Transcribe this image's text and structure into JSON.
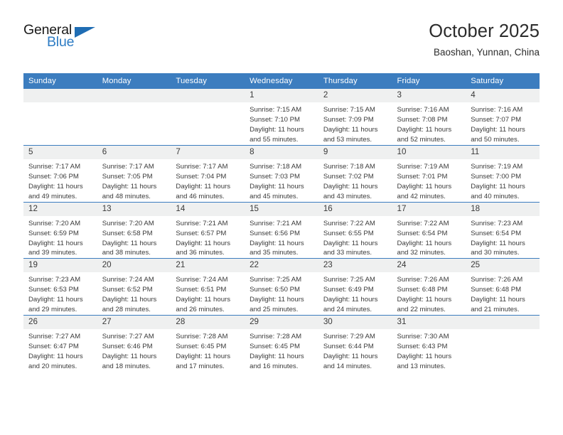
{
  "brand": {
    "name_top": "General",
    "name_bottom": "Blue",
    "triangle_color": "#1f6db4",
    "blue_text_color": "#2e7cc4"
  },
  "header": {
    "title": "October 2025",
    "subtitle": "Baoshan, Yunnan, China"
  },
  "colors": {
    "header_row_bg": "#3c7dbf",
    "header_row_text": "#ffffff",
    "daynum_bg": "#eff0f0",
    "row_divider": "#3c7dbf",
    "body_text": "#3a3a3a"
  },
  "calendar": {
    "weekday_headers": [
      "Sunday",
      "Monday",
      "Tuesday",
      "Wednesday",
      "Thursday",
      "Friday",
      "Saturday"
    ],
    "labels": {
      "sunrise": "Sunrise:",
      "sunset": "Sunset:",
      "daylight": "Daylight:"
    },
    "weeks": [
      [
        {
          "day": "",
          "blank": true
        },
        {
          "day": "",
          "blank": true
        },
        {
          "day": "",
          "blank": true
        },
        {
          "day": "1",
          "sunrise": "Sunrise: 7:15 AM",
          "sunset": "Sunset: 7:10 PM",
          "daylight_1": "Daylight: 11 hours",
          "daylight_2": "and 55 minutes."
        },
        {
          "day": "2",
          "sunrise": "Sunrise: 7:15 AM",
          "sunset": "Sunset: 7:09 PM",
          "daylight_1": "Daylight: 11 hours",
          "daylight_2": "and 53 minutes."
        },
        {
          "day": "3",
          "sunrise": "Sunrise: 7:16 AM",
          "sunset": "Sunset: 7:08 PM",
          "daylight_1": "Daylight: 11 hours",
          "daylight_2": "and 52 minutes."
        },
        {
          "day": "4",
          "sunrise": "Sunrise: 7:16 AM",
          "sunset": "Sunset: 7:07 PM",
          "daylight_1": "Daylight: 11 hours",
          "daylight_2": "and 50 minutes."
        }
      ],
      [
        {
          "day": "5",
          "sunrise": "Sunrise: 7:17 AM",
          "sunset": "Sunset: 7:06 PM",
          "daylight_1": "Daylight: 11 hours",
          "daylight_2": "and 49 minutes."
        },
        {
          "day": "6",
          "sunrise": "Sunrise: 7:17 AM",
          "sunset": "Sunset: 7:05 PM",
          "daylight_1": "Daylight: 11 hours",
          "daylight_2": "and 48 minutes."
        },
        {
          "day": "7",
          "sunrise": "Sunrise: 7:17 AM",
          "sunset": "Sunset: 7:04 PM",
          "daylight_1": "Daylight: 11 hours",
          "daylight_2": "and 46 minutes."
        },
        {
          "day": "8",
          "sunrise": "Sunrise: 7:18 AM",
          "sunset": "Sunset: 7:03 PM",
          "daylight_1": "Daylight: 11 hours",
          "daylight_2": "and 45 minutes."
        },
        {
          "day": "9",
          "sunrise": "Sunrise: 7:18 AM",
          "sunset": "Sunset: 7:02 PM",
          "daylight_1": "Daylight: 11 hours",
          "daylight_2": "and 43 minutes."
        },
        {
          "day": "10",
          "sunrise": "Sunrise: 7:19 AM",
          "sunset": "Sunset: 7:01 PM",
          "daylight_1": "Daylight: 11 hours",
          "daylight_2": "and 42 minutes."
        },
        {
          "day": "11",
          "sunrise": "Sunrise: 7:19 AM",
          "sunset": "Sunset: 7:00 PM",
          "daylight_1": "Daylight: 11 hours",
          "daylight_2": "and 40 minutes."
        }
      ],
      [
        {
          "day": "12",
          "sunrise": "Sunrise: 7:20 AM",
          "sunset": "Sunset: 6:59 PM",
          "daylight_1": "Daylight: 11 hours",
          "daylight_2": "and 39 minutes."
        },
        {
          "day": "13",
          "sunrise": "Sunrise: 7:20 AM",
          "sunset": "Sunset: 6:58 PM",
          "daylight_1": "Daylight: 11 hours",
          "daylight_2": "and 38 minutes."
        },
        {
          "day": "14",
          "sunrise": "Sunrise: 7:21 AM",
          "sunset": "Sunset: 6:57 PM",
          "daylight_1": "Daylight: 11 hours",
          "daylight_2": "and 36 minutes."
        },
        {
          "day": "15",
          "sunrise": "Sunrise: 7:21 AM",
          "sunset": "Sunset: 6:56 PM",
          "daylight_1": "Daylight: 11 hours",
          "daylight_2": "and 35 minutes."
        },
        {
          "day": "16",
          "sunrise": "Sunrise: 7:22 AM",
          "sunset": "Sunset: 6:55 PM",
          "daylight_1": "Daylight: 11 hours",
          "daylight_2": "and 33 minutes."
        },
        {
          "day": "17",
          "sunrise": "Sunrise: 7:22 AM",
          "sunset": "Sunset: 6:54 PM",
          "daylight_1": "Daylight: 11 hours",
          "daylight_2": "and 32 minutes."
        },
        {
          "day": "18",
          "sunrise": "Sunrise: 7:23 AM",
          "sunset": "Sunset: 6:54 PM",
          "daylight_1": "Daylight: 11 hours",
          "daylight_2": "and 30 minutes."
        }
      ],
      [
        {
          "day": "19",
          "sunrise": "Sunrise: 7:23 AM",
          "sunset": "Sunset: 6:53 PM",
          "daylight_1": "Daylight: 11 hours",
          "daylight_2": "and 29 minutes."
        },
        {
          "day": "20",
          "sunrise": "Sunrise: 7:24 AM",
          "sunset": "Sunset: 6:52 PM",
          "daylight_1": "Daylight: 11 hours",
          "daylight_2": "and 28 minutes."
        },
        {
          "day": "21",
          "sunrise": "Sunrise: 7:24 AM",
          "sunset": "Sunset: 6:51 PM",
          "daylight_1": "Daylight: 11 hours",
          "daylight_2": "and 26 minutes."
        },
        {
          "day": "22",
          "sunrise": "Sunrise: 7:25 AM",
          "sunset": "Sunset: 6:50 PM",
          "daylight_1": "Daylight: 11 hours",
          "daylight_2": "and 25 minutes."
        },
        {
          "day": "23",
          "sunrise": "Sunrise: 7:25 AM",
          "sunset": "Sunset: 6:49 PM",
          "daylight_1": "Daylight: 11 hours",
          "daylight_2": "and 24 minutes."
        },
        {
          "day": "24",
          "sunrise": "Sunrise: 7:26 AM",
          "sunset": "Sunset: 6:48 PM",
          "daylight_1": "Daylight: 11 hours",
          "daylight_2": "and 22 minutes."
        },
        {
          "day": "25",
          "sunrise": "Sunrise: 7:26 AM",
          "sunset": "Sunset: 6:48 PM",
          "daylight_1": "Daylight: 11 hours",
          "daylight_2": "and 21 minutes."
        }
      ],
      [
        {
          "day": "26",
          "sunrise": "Sunrise: 7:27 AM",
          "sunset": "Sunset: 6:47 PM",
          "daylight_1": "Daylight: 11 hours",
          "daylight_2": "and 20 minutes."
        },
        {
          "day": "27",
          "sunrise": "Sunrise: 7:27 AM",
          "sunset": "Sunset: 6:46 PM",
          "daylight_1": "Daylight: 11 hours",
          "daylight_2": "and 18 minutes."
        },
        {
          "day": "28",
          "sunrise": "Sunrise: 7:28 AM",
          "sunset": "Sunset: 6:45 PM",
          "daylight_1": "Daylight: 11 hours",
          "daylight_2": "and 17 minutes."
        },
        {
          "day": "29",
          "sunrise": "Sunrise: 7:28 AM",
          "sunset": "Sunset: 6:45 PM",
          "daylight_1": "Daylight: 11 hours",
          "daylight_2": "and 16 minutes."
        },
        {
          "day": "30",
          "sunrise": "Sunrise: 7:29 AM",
          "sunset": "Sunset: 6:44 PM",
          "daylight_1": "Daylight: 11 hours",
          "daylight_2": "and 14 minutes."
        },
        {
          "day": "31",
          "sunrise": "Sunrise: 7:30 AM",
          "sunset": "Sunset: 6:43 PM",
          "daylight_1": "Daylight: 11 hours",
          "daylight_2": "and 13 minutes."
        },
        {
          "day": "",
          "blank": true
        }
      ]
    ]
  }
}
